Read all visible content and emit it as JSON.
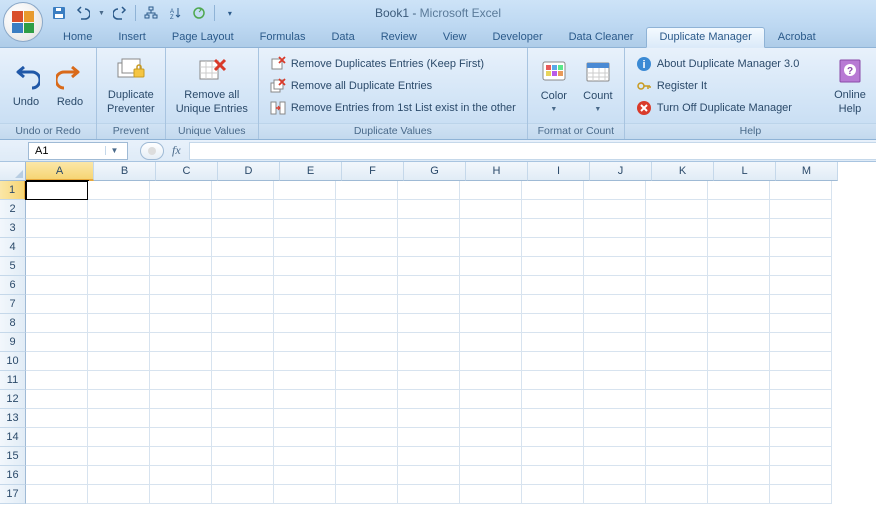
{
  "title": {
    "doc": "Book1",
    "app": "Microsoft Excel"
  },
  "qat": [
    "save",
    "undo",
    "redo",
    "open",
    "sort-asc",
    "refresh"
  ],
  "tabs": [
    {
      "label": "Home"
    },
    {
      "label": "Insert"
    },
    {
      "label": "Page Layout"
    },
    {
      "label": "Formulas"
    },
    {
      "label": "Data"
    },
    {
      "label": "Review"
    },
    {
      "label": "View"
    },
    {
      "label": "Developer"
    },
    {
      "label": "Data Cleaner"
    },
    {
      "label": "Duplicate Manager",
      "active": true
    },
    {
      "label": "Acrobat"
    }
  ],
  "ribbon": {
    "undo_redo": {
      "label": "Undo or Redo",
      "undo": "Undo",
      "redo": "Redo"
    },
    "prevent": {
      "label": "Prevent",
      "btn": "Duplicate\nPreventer"
    },
    "unique": {
      "label": "Unique Values",
      "btn": "Remove all\nUnique Entries"
    },
    "dup_values": {
      "label": "Duplicate Values",
      "items": [
        "Remove Duplicates Entries (Keep First)",
        "Remove all Duplicate Entries",
        "Remove Entries from 1st List exist in the other"
      ]
    },
    "format_count": {
      "label": "Format or Count",
      "color": "Color",
      "count": "Count"
    },
    "help": {
      "label": "Help",
      "items": [
        "About Duplicate Manager 3.0",
        "Register It",
        "Turn Off Duplicate Manager"
      ],
      "online": "Online\nHelp"
    }
  },
  "namebox": "A1",
  "fx_label": "fx",
  "columns": [
    "A",
    "B",
    "C",
    "D",
    "E",
    "F",
    "G",
    "H",
    "I",
    "J",
    "K",
    "L",
    "M"
  ],
  "rows": [
    "1",
    "2",
    "3",
    "4",
    "5",
    "6",
    "7",
    "8",
    "9",
    "10",
    "11",
    "12",
    "13",
    "14",
    "15",
    "16",
    "17"
  ],
  "active_cell": {
    "col": 0,
    "row": 0
  }
}
